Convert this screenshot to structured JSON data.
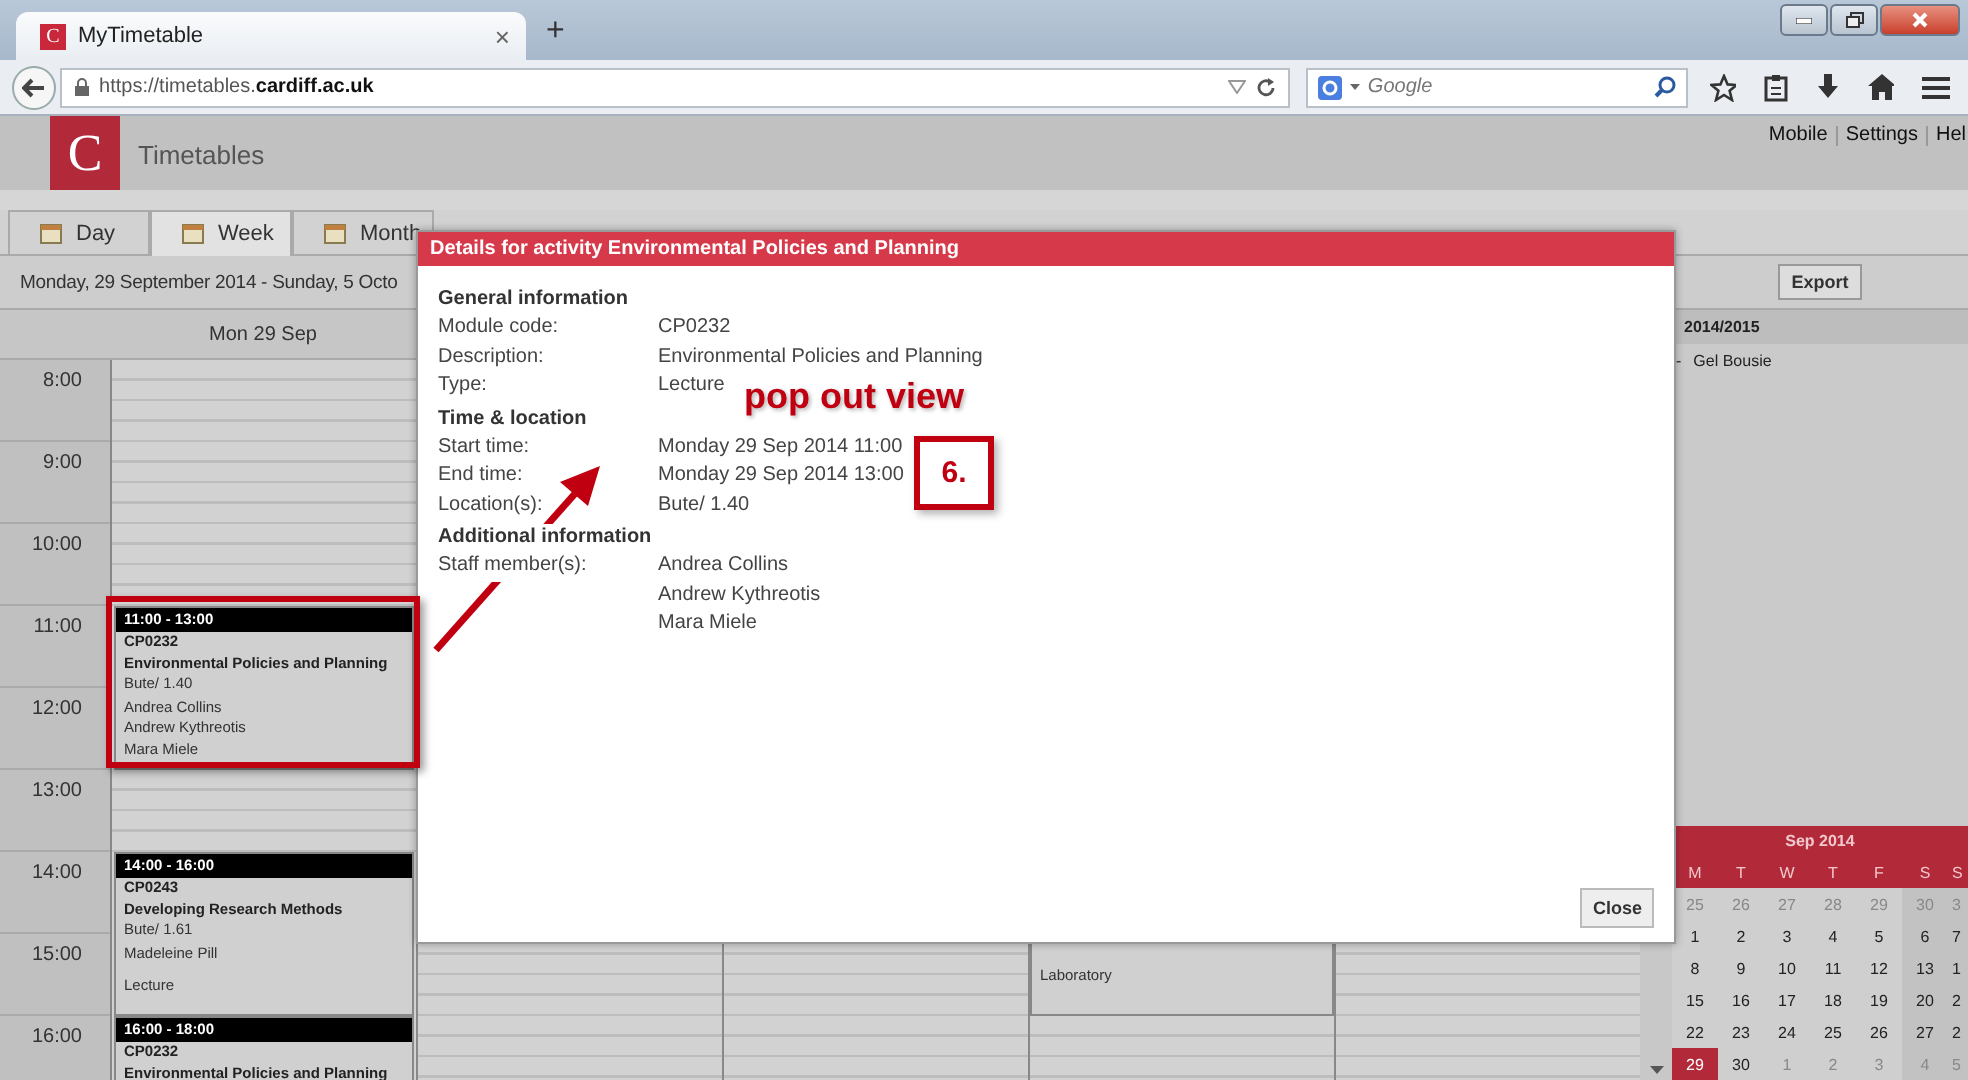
{
  "browser": {
    "favicon": "C",
    "tab_title": "MyTimetable",
    "tab_close": "×",
    "new_tab": "+",
    "url": "https://timetables.**cardiff.ac.uk**",
    "search_placeholder": "Google"
  },
  "app": {
    "logo": "C",
    "title": "Timetables",
    "links": [
      "Mobile",
      "Settings",
      "Hel"
    ]
  },
  "view_tabs": [
    {
      "label": "Day",
      "selected": false
    },
    {
      "label": "Week",
      "selected": true
    },
    {
      "label": "Month",
      "selected": false
    }
  ],
  "date_range": "Monday, 29 September 2014 - Sunday, 5 Octo",
  "export_button": "Export",
  "calendar": {
    "day_heading": "Mon 29 Sep",
    "hours": [
      "8:00",
      "9:00",
      "10:00",
      "11:00",
      "12:00",
      "13:00",
      "14:00",
      "15:00",
      "16:00"
    ],
    "monday_slots": [
      {
        "kind": "empty"
      },
      {
        "kind": "empty"
      },
      {
        "kind": "empty"
      },
      {
        "kind": "event",
        "time": "11:00 - 13:00",
        "code": "CP0232",
        "title": "Environmental Policies and Planning",
        "room": "Bute/ 1.40",
        "staff": [
          "Andrea Collins",
          "Andrew Kythreotis",
          "Mara Miele"
        ]
      },
      {
        "kind": "empty"
      },
      {
        "kind": "event",
        "time": "14:00 - 16:00",
        "code": "CP0243",
        "title": "Developing Research Methods",
        "room": "Bute/ 1.61",
        "staff": [
          "Madeleine Pill"
        ],
        "type": "Lecture"
      },
      {
        "kind": "event",
        "time": "16:00 - 18:00",
        "code": "CP0232",
        "title": "Environmental Policies and Planning"
      }
    ],
    "other_columns": [
      {
        "kind": "blank"
      },
      {
        "kind": "blank"
      },
      {
        "kind": "event_tail",
        "lines": [
          "Laboratory"
        ]
      },
      {
        "kind": "blank"
      }
    ]
  },
  "side_panel": {
    "year": "2014/2015",
    "items": [
      {
        "bullet": "-",
        "name": "Gel Bousie"
      }
    ]
  },
  "mini_calendar": {
    "title": "Sep 2014",
    "weekdays": [
      "M",
      "T",
      "W",
      "T",
      "F",
      "S",
      "S"
    ],
    "weeks": [
      [
        {
          "day": "25",
          "other_month": true,
          "selected": false
        },
        {
          "day": "26",
          "other_month": true,
          "selected": false
        },
        {
          "day": "27",
          "other_month": true,
          "selected": false
        },
        {
          "day": "28",
          "other_month": true,
          "selected": false
        },
        {
          "day": "29",
          "other_month": true,
          "selected": false
        },
        {
          "day": "30",
          "other_month": true,
          "selected": false
        },
        {
          "day": "3",
          "other_month": true,
          "selected": false
        }
      ],
      [
        {
          "day": "1",
          "other_month": false,
          "selected": false
        },
        {
          "day": "2",
          "other_month": false,
          "selected": false
        },
        {
          "day": "3",
          "other_month": false,
          "selected": false
        },
        {
          "day": "4",
          "other_month": false,
          "selected": false
        },
        {
          "day": "5",
          "other_month": false,
          "selected": false
        },
        {
          "day": "6",
          "other_month": false,
          "selected": false
        },
        {
          "day": "7",
          "other_month": false,
          "selected": false
        }
      ],
      [
        {
          "day": "8",
          "other_month": false,
          "selected": false
        },
        {
          "day": "9",
          "other_month": false,
          "selected": false
        },
        {
          "day": "10",
          "other_month": false,
          "selected": false
        },
        {
          "day": "11",
          "other_month": false,
          "selected": false
        },
        {
          "day": "12",
          "other_month": false,
          "selected": false
        },
        {
          "day": "13",
          "other_month": false,
          "selected": false
        },
        {
          "day": "1",
          "other_month": false,
          "selected": false
        }
      ],
      [
        {
          "day": "15",
          "other_month": false,
          "selected": false
        },
        {
          "day": "16",
          "other_month": false,
          "selected": false
        },
        {
          "day": "17",
          "other_month": false,
          "selected": false
        },
        {
          "day": "18",
          "other_month": false,
          "selected": false
        },
        {
          "day": "19",
          "other_month": false,
          "selected": false
        },
        {
          "day": "20",
          "other_month": false,
          "selected": false
        },
        {
          "day": "2",
          "other_month": false,
          "selected": false
        }
      ],
      [
        {
          "day": "22",
          "other_month": false,
          "selected": false
        },
        {
          "day": "23",
          "other_month": false,
          "selected": false
        },
        {
          "day": "24",
          "other_month": false,
          "selected": false
        },
        {
          "day": "25",
          "other_month": false,
          "selected": false
        },
        {
          "day": "26",
          "other_month": false,
          "selected": false
        },
        {
          "day": "27",
          "other_month": false,
          "selected": false
        },
        {
          "day": "2",
          "other_month": false,
          "selected": false
        }
      ],
      [
        {
          "day": "29",
          "other_month": false,
          "selected": true
        },
        {
          "day": "30",
          "other_month": false,
          "selected": false
        },
        {
          "day": "1",
          "other_month": true,
          "selected": false
        },
        {
          "day": "2",
          "other_month": true,
          "selected": false
        },
        {
          "day": "3",
          "other_month": true,
          "selected": false
        },
        {
          "day": "4",
          "other_month": true,
          "selected": false
        },
        {
          "day": "5",
          "other_month": true,
          "selected": false
        }
      ]
    ]
  },
  "dialog": {
    "title": "Details for activity Environmental Policies and Planning",
    "sections": [
      {
        "heading": "General information",
        "rows": [
          {
            "label": "Module code:",
            "values": [
              "CP0232"
            ]
          },
          {
            "label": "Description:",
            "values": [
              "Environmental Policies and Planning"
            ]
          },
          {
            "label": "Type:",
            "values": [
              "Lecture"
            ]
          }
        ]
      },
      {
        "heading": "Time & location",
        "rows": [
          {
            "label": "Start time:",
            "values": [
              "Monday 29 Sep 2014 11:00"
            ]
          },
          {
            "label": "End time:",
            "values": [
              "Monday 29 Sep 2014 13:00"
            ]
          },
          {
            "label": "Location(s):",
            "values": [
              "Bute/ 1.40"
            ]
          }
        ]
      },
      {
        "heading": "Additional information",
        "rows": [
          {
            "label": "Staff member(s):",
            "values": [
              "Andrea Collins",
              "Andrew Kythreotis",
              "Mara Miele"
            ]
          }
        ]
      }
    ],
    "close_button": "Close"
  },
  "annotation": {
    "caption": "pop out view",
    "step": "6."
  }
}
